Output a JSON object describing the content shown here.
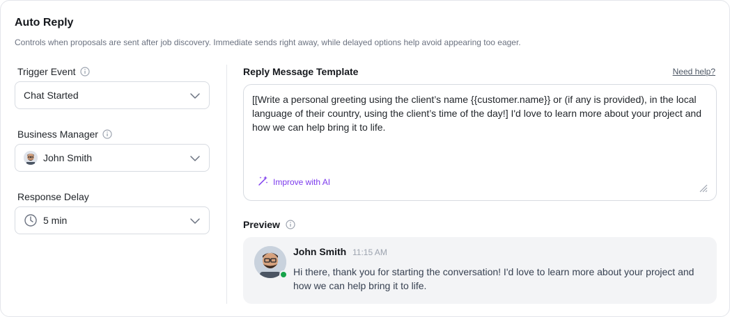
{
  "header": {
    "title": "Auto Reply",
    "subtitle": "Controls when proposals are sent after job discovery. Immediate sends right away, while delayed options help avoid appearing too eager."
  },
  "settings": {
    "trigger": {
      "label": "Trigger Event",
      "value": "Chat Started",
      "icon": "info-icon"
    },
    "manager": {
      "label": "Business Manager",
      "value": "John Smith",
      "icon": "info-icon"
    },
    "delay": {
      "label": "Response Delay",
      "value": "5 min",
      "icon": "clock-icon"
    }
  },
  "template": {
    "label": "Reply Message Template",
    "help_link": "Need help?",
    "text": "[[Write a personal greeting using the client’s name {{customer.name}} or (if any is provided), in the local language of their country, using the client’s time of the day!] I'd love to learn more about your project and how we can help bring it to life.",
    "ai_button": "Improve with AI"
  },
  "preview": {
    "label": "Preview",
    "name": "John Smith",
    "time": "11:15 AM",
    "message": "Hi there, thank you for starting the conversation! I'd love to learn more about your project and how we can help bring it to life.",
    "status": "online"
  },
  "colors": {
    "accent": "#7c3aed",
    "online": "#16a34a"
  }
}
